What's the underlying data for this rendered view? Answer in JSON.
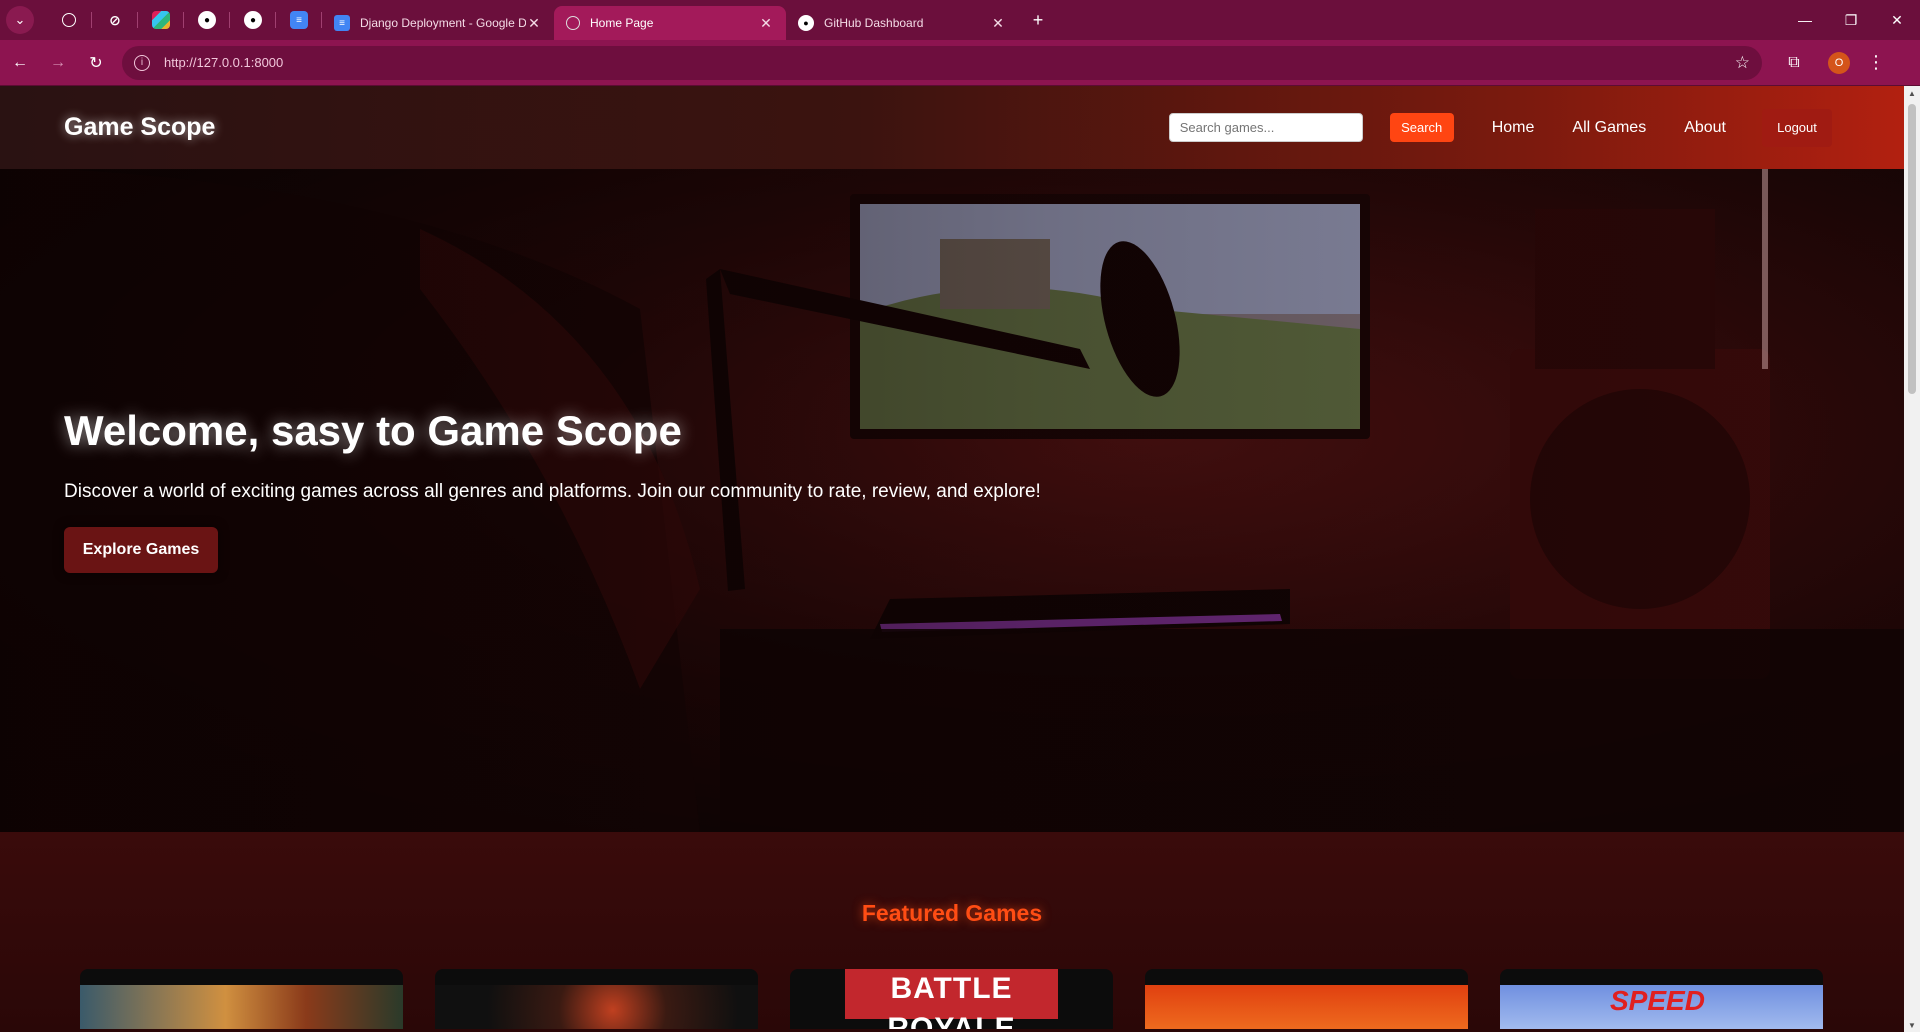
{
  "browser": {
    "pinned_tabs": [
      "openai-icon",
      "perplexity-icon",
      "slack-icon",
      "github-icon",
      "github-icon",
      "docs-icon"
    ],
    "tabs": [
      {
        "title": "Django Deployment - Google D",
        "icon": "docs-icon"
      },
      {
        "title": "Home Page",
        "icon": "globe-icon"
      },
      {
        "title": "GitHub Dashboard",
        "icon": "github-icon"
      }
    ],
    "url": "http://127.0.0.1:8000",
    "profile_initial": "O"
  },
  "site": {
    "logo": "Game Scope",
    "search_placeholder": "Search games...",
    "search_button": "Search",
    "nav": [
      "Home",
      "All Games",
      "About"
    ],
    "logout": "Logout"
  },
  "hero": {
    "title": "Welcome, sasy to Game Scope",
    "subtitle": "Discover a world of exciting games across all genres and platforms. Join our community to rate, review, and explore!",
    "cta": "Explore Games"
  },
  "featured": {
    "title": "Featured Games",
    "cards": [
      {
        "label": ""
      },
      {
        "label": ""
      },
      {
        "label": "BATTLE ROYALE"
      },
      {
        "label": ""
      },
      {
        "label": "SPEED"
      }
    ]
  },
  "colors": {
    "accent": "#ff4512",
    "tabbar": "#6b0f3c",
    "addressbar": "#8d1450"
  }
}
